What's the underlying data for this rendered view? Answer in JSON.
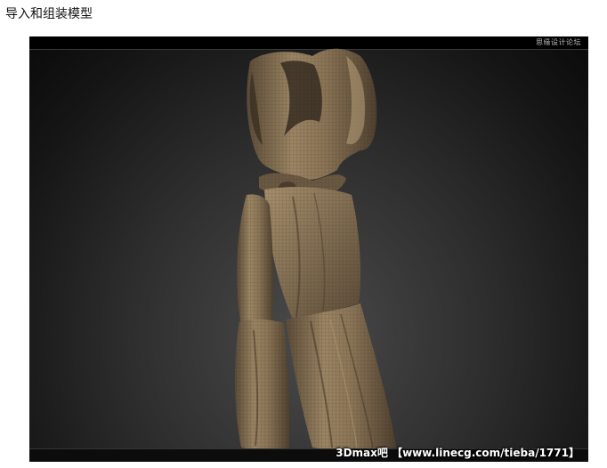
{
  "page": {
    "heading": "导入和组装模型"
  },
  "viewport": {
    "top_label": "思缘设计论坛",
    "subject_icon": "garment-3d-model",
    "watermark": "3Dmax吧 【www.linecg.com/tieba/1771】"
  },
  "colors": {
    "background": "#ffffff",
    "viewport_dark": "#0a0a0a",
    "clay": "#8a7558"
  }
}
